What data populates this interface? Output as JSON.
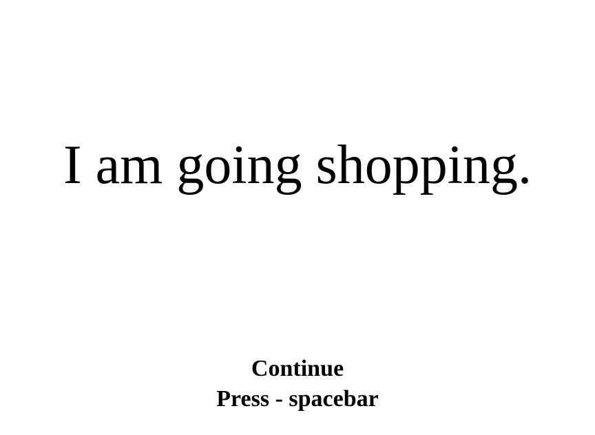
{
  "stimulus": {
    "text": "I am going shopping."
  },
  "prompt": {
    "continue_label": "Continue",
    "instruction": "Press - spacebar"
  },
  "colors": {
    "background": "#ffffff",
    "text": "#000000"
  }
}
